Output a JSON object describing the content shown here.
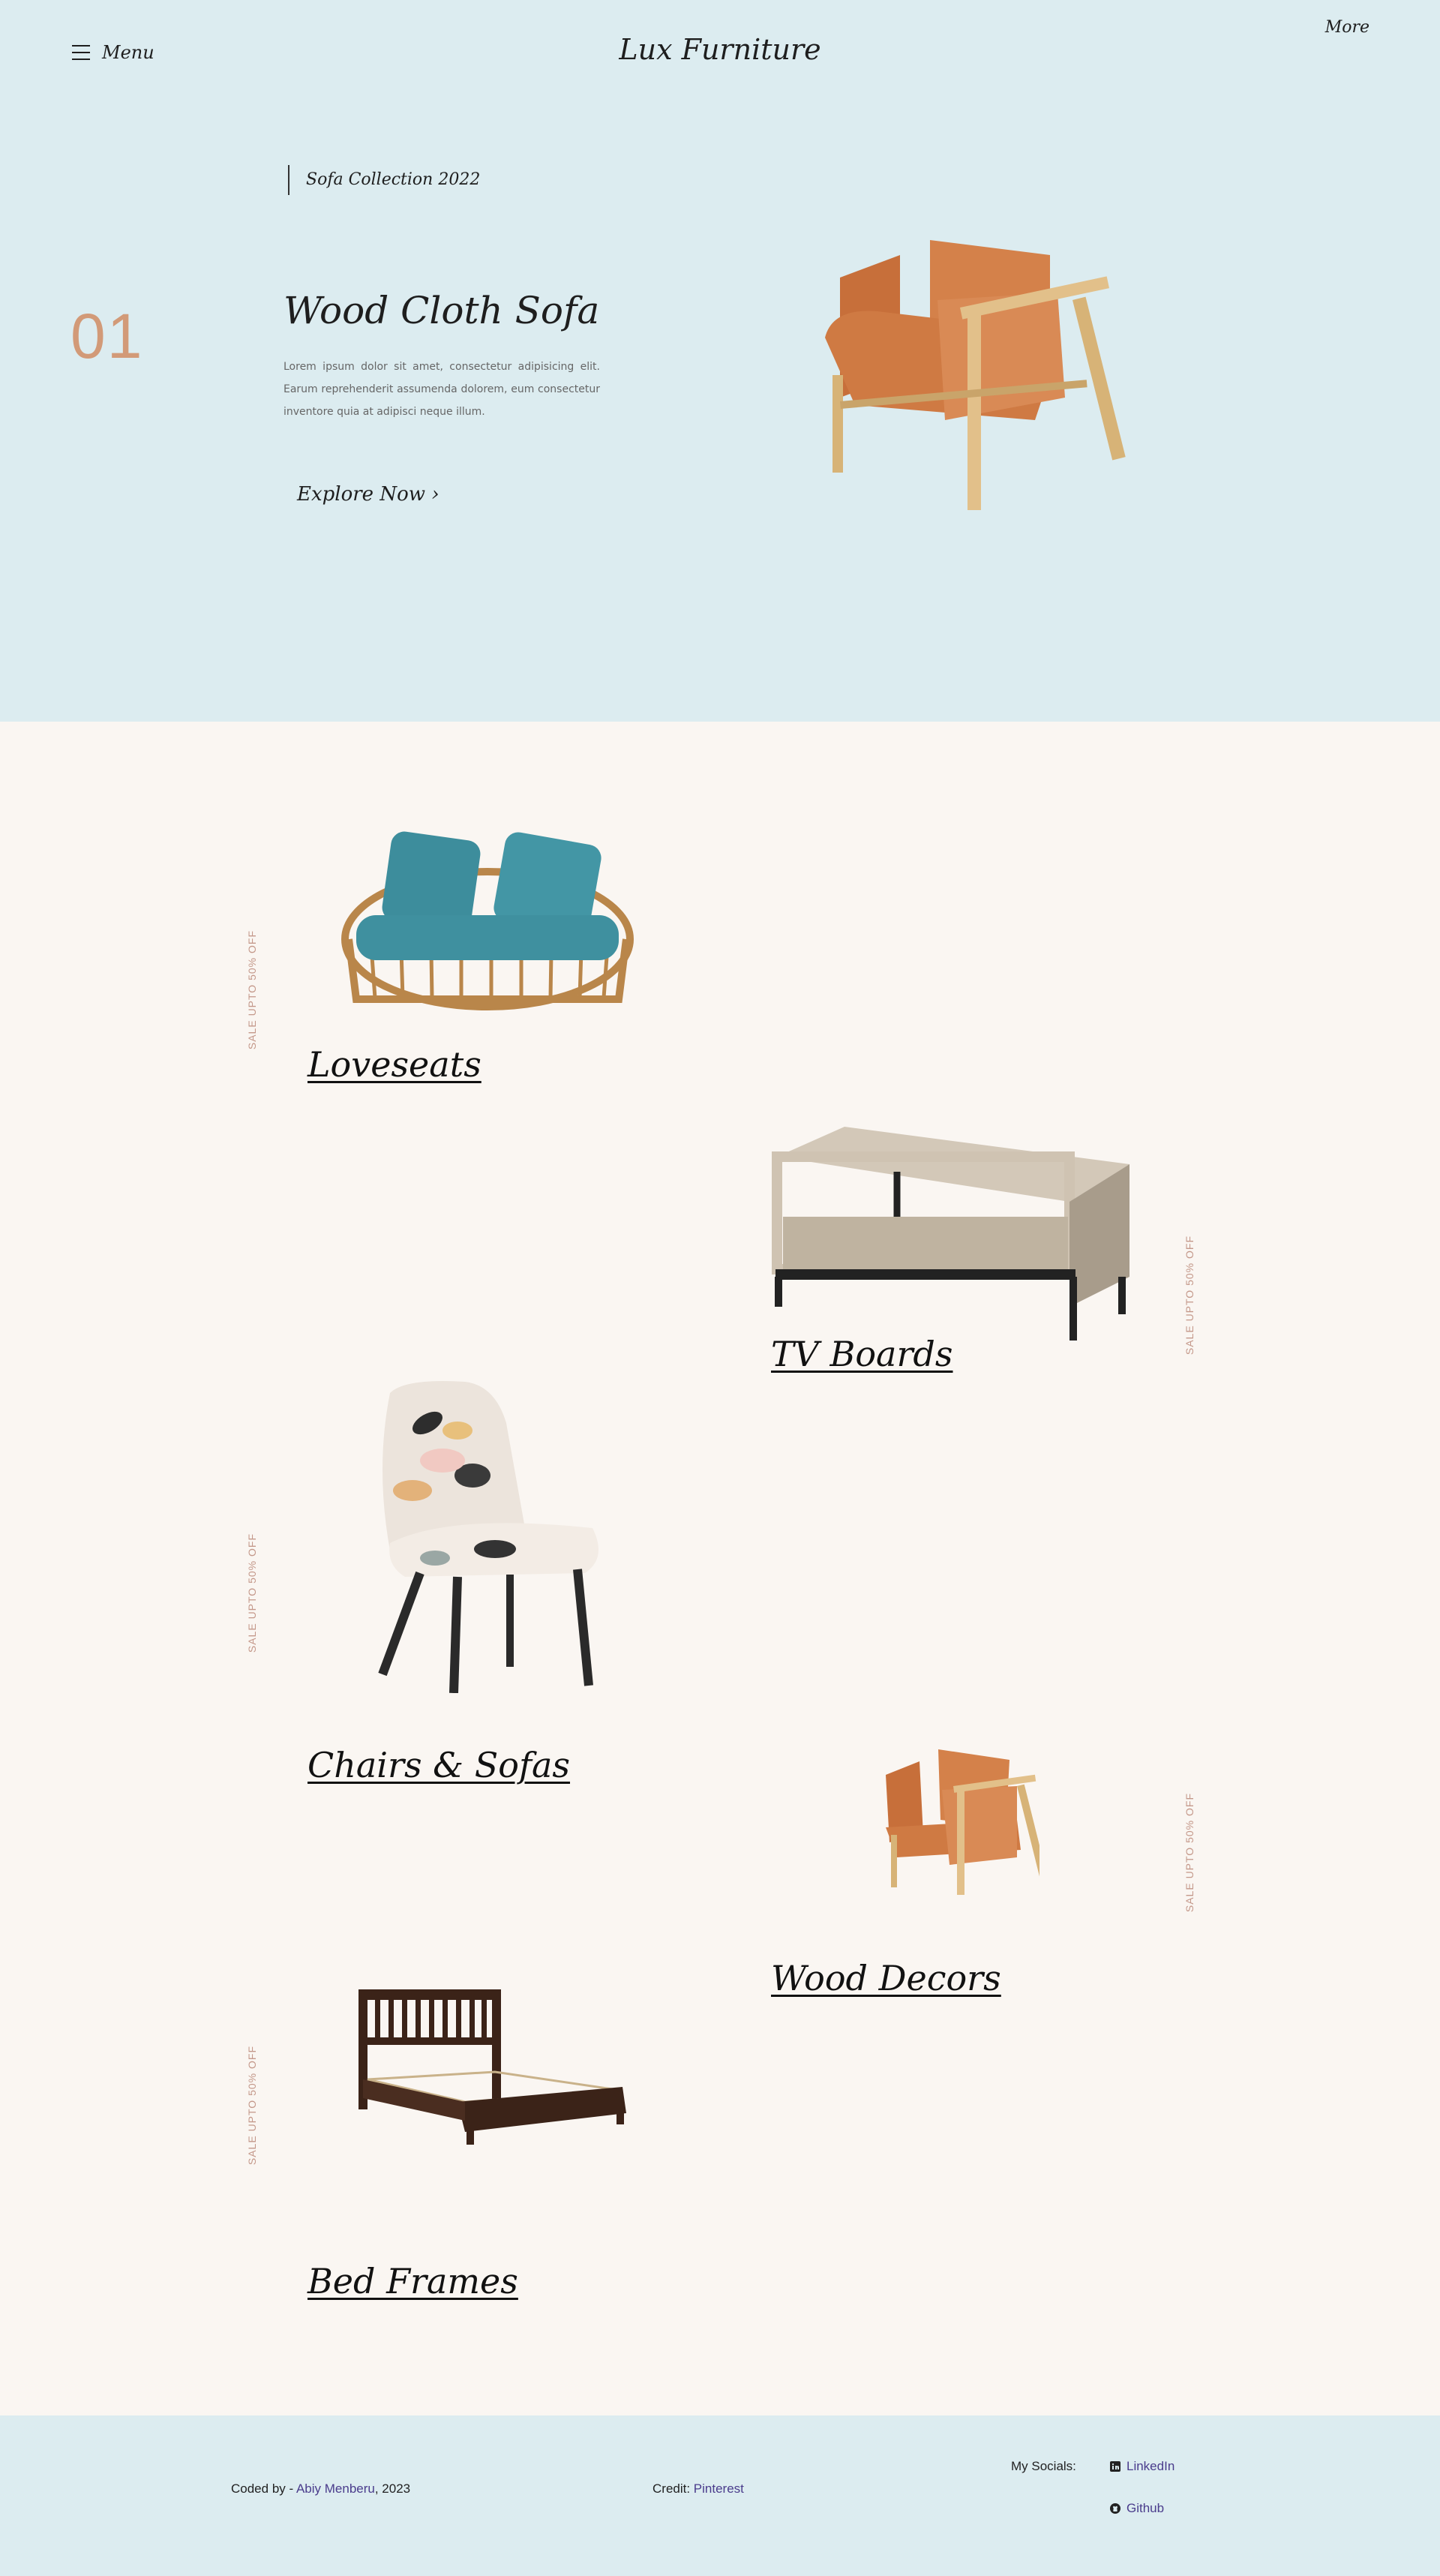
{
  "header": {
    "menu_label": "Menu",
    "brand": "Lux Furniture",
    "more_label": "More"
  },
  "hero": {
    "collection": "Sofa Collection 2022",
    "number": "01",
    "title": "Wood Cloth Sofa",
    "description": "Lorem ipsum dolor sit amet, consectetur adipisicing elit. Earum reprehenderit assumenda dolorem, eum consectetur inventore quia at adipisci neque illum.",
    "cta": "Explore Now ›"
  },
  "categories": [
    {
      "title": "Loveseats",
      "sale": "SALE UPTO 50% OFF"
    },
    {
      "title": "TV Boards",
      "sale": "SALE UPTO 50% OFF"
    },
    {
      "title": "Chairs & Sofas",
      "sale": "SALE UPTO 50% OFF"
    },
    {
      "title": "Wood Decors",
      "sale": "SALE UPTO 50% OFF"
    },
    {
      "title": "Bed Frames",
      "sale": "SALE UPTO 50% OFF"
    }
  ],
  "footer": {
    "coded_by": "Coded by - ",
    "author": "Abiy Menberu",
    "year": ", 2023",
    "credit_label": "Credit: ",
    "credit_link": "Pinterest",
    "socials_label": "My Socials:",
    "linkedin": "LinkedIn",
    "github": "Github"
  },
  "colors": {
    "hero_bg": "#dcecf0",
    "page_bg": "#faf6f2",
    "accent": "#d29a78",
    "link": "#4a3c8c"
  }
}
